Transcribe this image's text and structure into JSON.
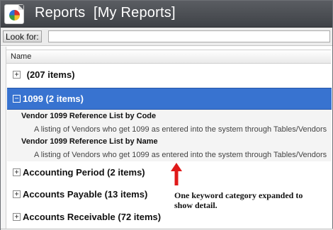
{
  "window": {
    "title": "Reports  [My Reports]",
    "icon": "reports-app-icon"
  },
  "search": {
    "label": "Look for:",
    "value": "",
    "placeholder": ""
  },
  "grid": {
    "column_header": "Name",
    "groups": [
      {
        "expander": "+",
        "label": " (207 items)",
        "expanded": false
      },
      {
        "expander": "-",
        "label": "1099 (2 items)",
        "expanded": true
      },
      {
        "expander": "+",
        "label": "Accounting Period (2 items)",
        "expanded": false
      },
      {
        "expander": "+",
        "label": "Accounts Payable (13 items)",
        "expanded": false
      },
      {
        "expander": "+",
        "label": "Accounts Receivable (72 items)",
        "expanded": false
      }
    ],
    "reports": [
      {
        "name": "Vendor 1099 Reference List by Code",
        "description": "A listing of Vendors who get 1099 as entered into the system through Tables/Vendors"
      },
      {
        "name": "Vendor 1099 Reference List by Name",
        "description": "A listing of Vendors who get 1099 as entered into the system through Tables/Vendors"
      }
    ]
  },
  "annotation": {
    "text": "One keyword category expanded to show detail.",
    "arrow_color": "#e01a1a"
  },
  "colors": {
    "titlebar": "#4a4d52",
    "selected_row": "#3873d0",
    "report_row": "#f4f4f4"
  }
}
